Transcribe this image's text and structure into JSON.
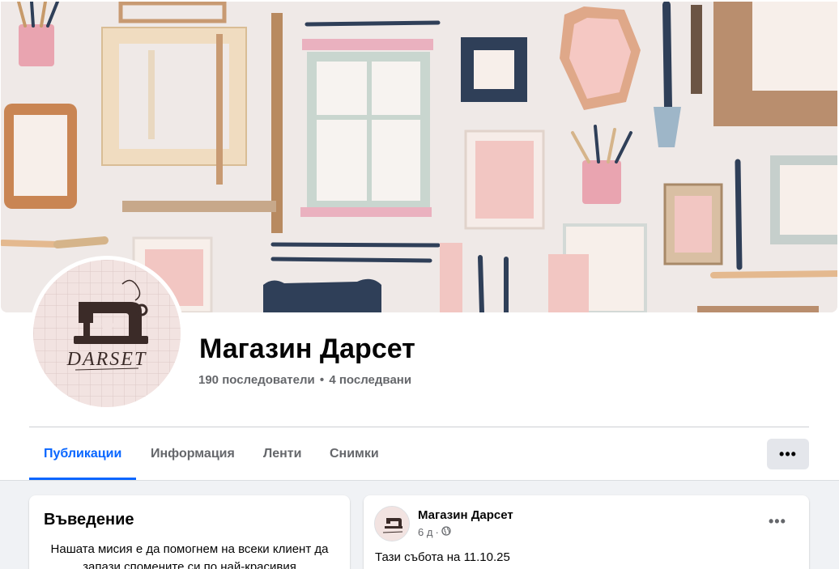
{
  "page": {
    "name": "Магазин Дарсет",
    "followers": "190 последователи",
    "separator": "•",
    "following": "4 последвани",
    "avatar_logo_text": "DARSET"
  },
  "tabs": [
    {
      "label": "Публикации",
      "active": true
    },
    {
      "label": "Информация",
      "active": false
    },
    {
      "label": "Ленти",
      "active": false
    },
    {
      "label": "Снимки",
      "active": false
    }
  ],
  "more_button": {
    "label": "•••",
    "icon": "more-horizontal-icon"
  },
  "intro": {
    "title": "Въведение",
    "text": "Нашата мисия е да помогнем на всеки клиент да запази спомените си по най-красивия"
  },
  "post": {
    "author": "Магазин Дарсет",
    "time": "6 д",
    "meta_separator": "·",
    "privacy_icon": "globe-icon",
    "more_label": "•••",
    "text": "Тази събота на 11.10.25"
  },
  "colors": {
    "accent": "#0866ff",
    "text_primary": "#050505",
    "text_secondary": "#65676b",
    "cover_background": "#efe9e7",
    "avatar_background": "#f2e3e1"
  }
}
